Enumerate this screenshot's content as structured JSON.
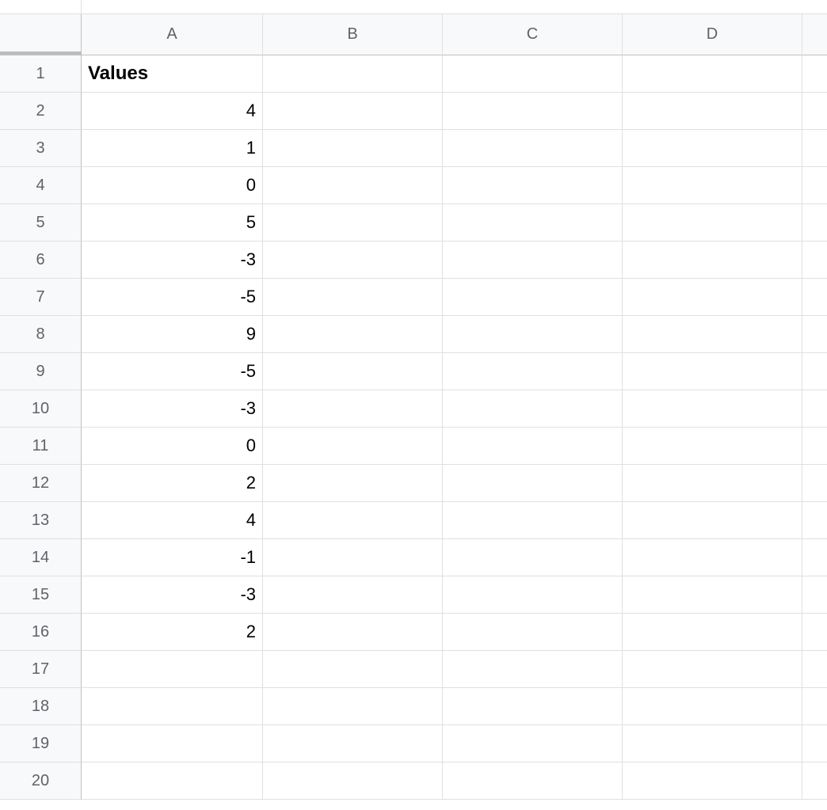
{
  "columns": [
    "A",
    "B",
    "C",
    "D"
  ],
  "rows": [
    "1",
    "2",
    "3",
    "4",
    "5",
    "6",
    "7",
    "8",
    "9",
    "10",
    "11",
    "12",
    "13",
    "14",
    "15",
    "16",
    "17",
    "18",
    "19",
    "20"
  ],
  "cells": {
    "A1": {
      "value": "Values",
      "bold": true,
      "align": "left"
    },
    "A2": {
      "value": "4",
      "align": "right"
    },
    "A3": {
      "value": "1",
      "align": "right"
    },
    "A4": {
      "value": "0",
      "align": "right"
    },
    "A5": {
      "value": "5",
      "align": "right"
    },
    "A6": {
      "value": "-3",
      "align": "right"
    },
    "A7": {
      "value": "-5",
      "align": "right"
    },
    "A8": {
      "value": "9",
      "align": "right"
    },
    "A9": {
      "value": "-5",
      "align": "right"
    },
    "A10": {
      "value": "-3",
      "align": "right"
    },
    "A11": {
      "value": "0",
      "align": "right"
    },
    "A12": {
      "value": "2",
      "align": "right"
    },
    "A13": {
      "value": "4",
      "align": "right"
    },
    "A14": {
      "value": "-1",
      "align": "right"
    },
    "A15": {
      "value": "-3",
      "align": "right"
    },
    "A16": {
      "value": "2",
      "align": "right"
    }
  }
}
